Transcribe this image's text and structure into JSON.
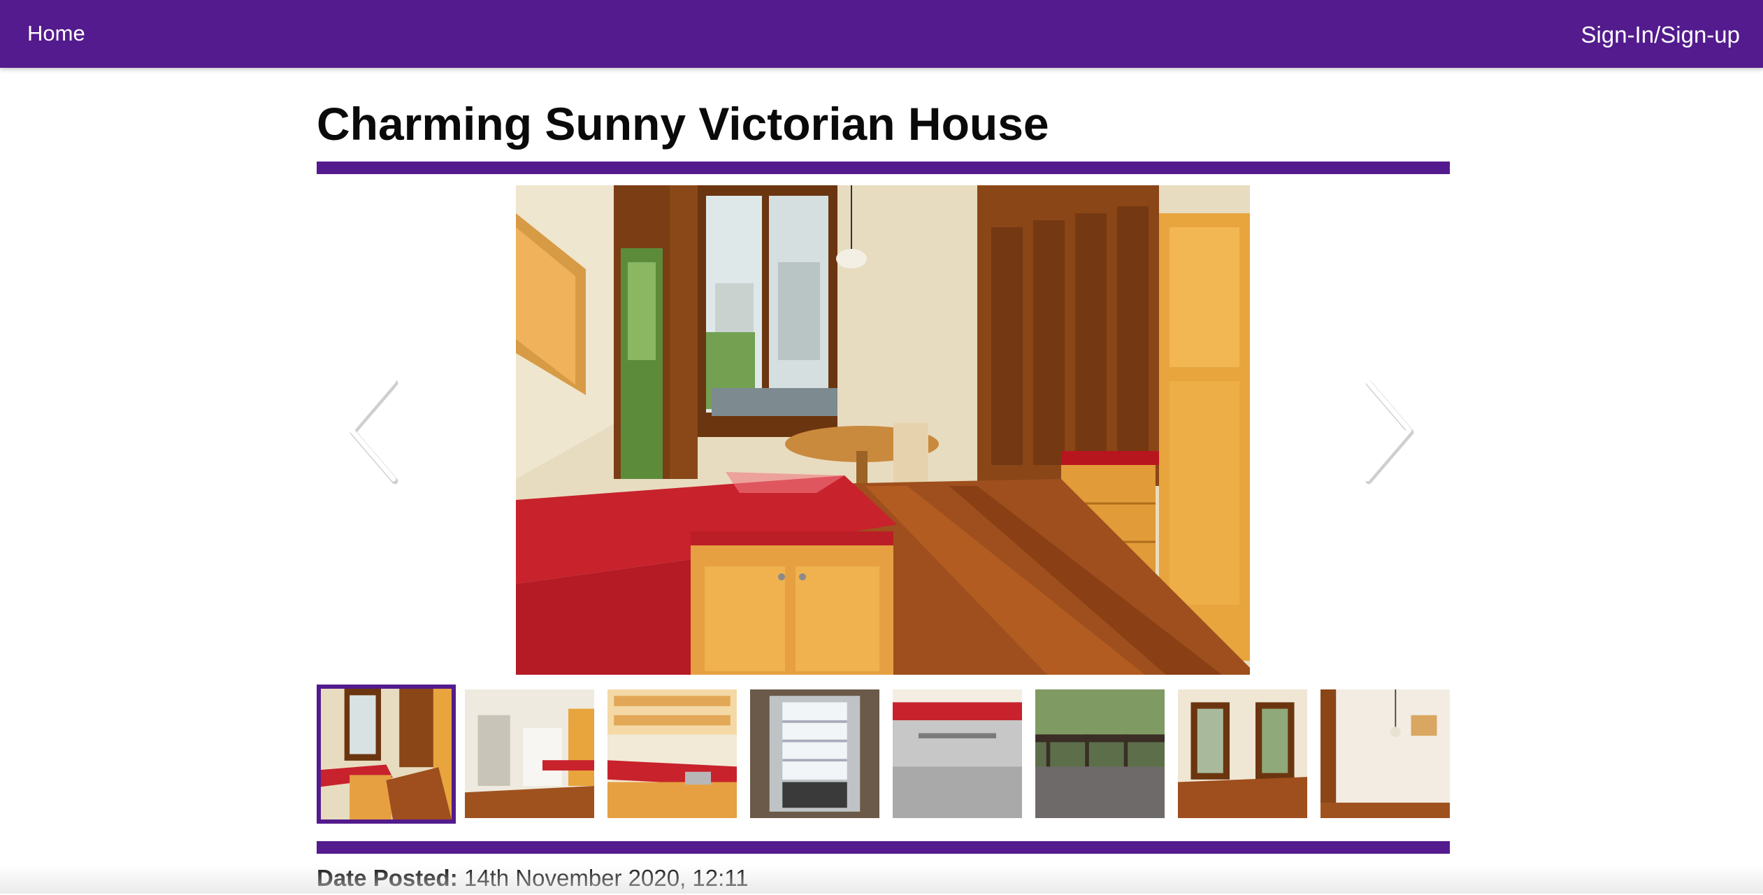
{
  "nav": {
    "home_label": "Home",
    "signin_label": "Sign-In/Sign-up"
  },
  "listing": {
    "title": "Charming Sunny Victorian House",
    "date_label": "Date Posted:",
    "date_value": "14th November 2020, 12:11"
  },
  "gallery": {
    "prev_icon": "chevron-left-icon",
    "next_icon": "chevron-right-icon",
    "thumbnails": [
      {
        "subject": "kitchen with red counter and dining nook",
        "active": true
      },
      {
        "subject": "white kitchen with island"
      },
      {
        "subject": "kitchen counters and shelves"
      },
      {
        "subject": "open refrigerator"
      },
      {
        "subject": "stainless dishwasher"
      },
      {
        "subject": "deck with railing and plants"
      },
      {
        "subject": "room with french doors"
      },
      {
        "subject": "empty room with pendant light"
      }
    ]
  },
  "colors": {
    "brand": "#531b8d",
    "counter_red": "#c8222c",
    "wood": "#a0521e"
  }
}
